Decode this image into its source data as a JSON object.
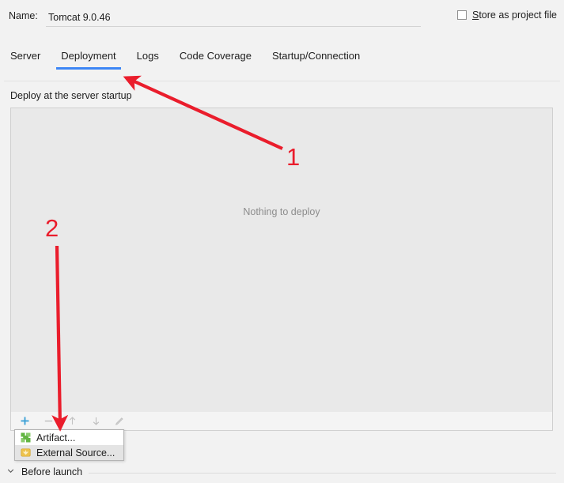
{
  "name_row": {
    "label": "Name:",
    "value": "Tomcat 9.0.46",
    "placeholder": "",
    "store_checkbox": {
      "mnemonic": "S",
      "rest": "tore as project file",
      "checked": false
    }
  },
  "tabs": [
    {
      "label": "Server",
      "active": false
    },
    {
      "label": "Deployment",
      "active": true
    },
    {
      "label": "Logs",
      "active": false
    },
    {
      "label": "Code Coverage",
      "active": false
    },
    {
      "label": "Startup/Connection",
      "active": false
    }
  ],
  "panel": {
    "deploy_label": "Deploy at the server startup",
    "empty_text": "Nothing to deploy",
    "toolbar": [
      {
        "icon": "plus-icon",
        "glyph": "+",
        "enabled": true
      },
      {
        "icon": "minus-icon",
        "glyph": "−",
        "enabled": false
      },
      {
        "icon": "arrow-up-icon",
        "glyph": "↑",
        "enabled": false
      },
      {
        "icon": "arrow-down-icon",
        "glyph": "↓",
        "enabled": false
      },
      {
        "icon": "pencil-icon",
        "glyph": "✎",
        "enabled": false
      }
    ]
  },
  "popup_menu": {
    "items": [
      {
        "label": "Artifact...",
        "icon": "artifact-icon",
        "hovered": false
      },
      {
        "label": "External Source...",
        "icon": "external-source-icon",
        "hovered": true
      }
    ]
  },
  "before_launch": {
    "label": "Before launch",
    "expanded": true
  },
  "annotations": [
    {
      "number": "1"
    },
    {
      "number": "2"
    }
  ],
  "colors": {
    "accent_tab": "#3d86f5",
    "annotation_red": "#ea1d2c",
    "plus_teal": "#389fd6",
    "artifact_green": "#62b543",
    "external_orange": "#edc24c",
    "panel_bg": "#f2f2f2",
    "list_bg": "#e9e9e9",
    "placeholder_text": "#8c8c8c"
  }
}
